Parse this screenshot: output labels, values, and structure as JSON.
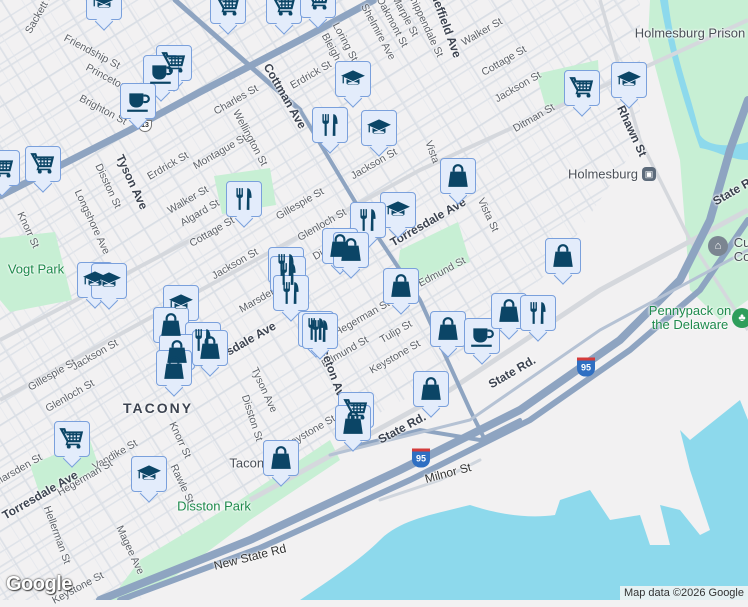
{
  "map": {
    "labels": {
      "sackett": "Sackett St",
      "friendship": "Friendship St",
      "princeton": "Princeton Ave",
      "brighton": "Brighton St",
      "charles": "Charles St",
      "wellington": "Wellington St",
      "cottman": "Cottman Ave",
      "erdrick1": "Erdrick St",
      "loring": "Loring St",
      "bleigh": "Bleigh",
      "shelmire": "Shelmire Ave",
      "oakmont": "Oakmont St",
      "marple": "Marple St",
      "chippendale": "Chippendale St",
      "sheffield": "Sheffield Ave",
      "walker1": "Walker St",
      "cottage1": "Cottage St",
      "jackson1": "Jackson St",
      "ditman": "Ditman St",
      "rhawn": "Rhawn St",
      "holmesburg": "Holmesburg",
      "prison": "Holmesburg Prison",
      "vista1": "Vista",
      "vista2": "Vista St",
      "torresdale1": "Torresdale Ave",
      "edmund1": "Edmund St",
      "hegerman1": "Hegerman St",
      "tulip": "Tulip St",
      "keystone1": "Keystone St",
      "state1": "State Rd.",
      "state2": "State Rd.",
      "state3": "State Rd",
      "milnor": "Milnor St",
      "pennypack": "Pennypack on the Delaware",
      "newstate": "New State Rd",
      "disstonpark": "Disston Park",
      "tacony": "TACONY",
      "tacony2": "Tacony",
      "knorr1": "Knorr St",
      "rawle": "Rawle St",
      "vandike": "Vandike St",
      "hegerman2": "Hegerman St",
      "hellerman": "Hellerman St",
      "magee": "Magee Ave",
      "keystone2": "Keystone St",
      "torresdale2": "Torresdale Ave",
      "marsden1": "Marsden St",
      "glenloch1": "Glenloch St",
      "gillespie1": "Gillespie St",
      "jackson2": "Jackson St",
      "tyson1": "Tyson Ave",
      "disston1": "Disston St",
      "longshore": "Longshore Ave",
      "knorr2": "Knorr St",
      "erdrick2": "Erdrick St",
      "montague": "Montague St",
      "walker2": "Walker St",
      "algard": "Algard St",
      "cottage2": "Cottage St",
      "gillespie2": "Gillespie St",
      "glenloch2": "Glenloch St",
      "jackson3": "Jackson St",
      "jackson4": "Jackson St",
      "marsden2": "Marsden",
      "torresdale3": "Torresdale Ave",
      "tyson2": "Tyson Ave",
      "disston2": "Disston St",
      "edmund2": "Edmund St",
      "keystone3": "Keystone St",
      "princeton2": "Princeton Ave",
      "vogt": "Vogt Park",
      "cu": "Cu\nCo",
      "dit": "Di"
    },
    "highway_shields": [
      "95",
      "95",
      "95",
      "13"
    ],
    "marker_types": [
      "grocery-cart",
      "coffee-cup",
      "graduation-cap",
      "fork-knife",
      "shopping-bag"
    ],
    "attribution": "Map data ©2026 Google",
    "logo": "Google"
  },
  "colors": {
    "land": "#f2f1f2",
    "water": "#8dd9ec",
    "park": "#c7efd4",
    "highway": "#8ea4c1",
    "marker_fill": "#e3ecfb",
    "marker_icon": "#0b4566"
  }
}
